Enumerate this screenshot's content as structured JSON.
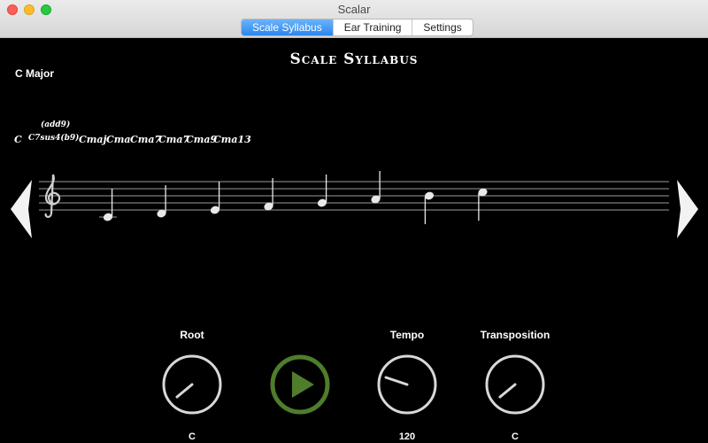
{
  "window": {
    "title": "Scalar"
  },
  "tabs": [
    {
      "label": "Scale Syllabus",
      "active": true
    },
    {
      "label": "Ear Training",
      "active": false
    },
    {
      "label": "Settings",
      "active": false
    }
  ],
  "main": {
    "title": "Scale Syllabus",
    "scale_name": "C Major",
    "chords": {
      "c": "C",
      "c7sus4": "C7sus4(b9)",
      "c7sus4_super": "(add9)",
      "cmaj": "Cmaj",
      "cma": "Cma",
      "cma7": "Cma7",
      "cma7b": "Cma7",
      "cma9": "Cma9",
      "cma13": "Cma13"
    },
    "notes": [
      "C4",
      "D4",
      "E4",
      "F4",
      "G4",
      "A4",
      "B4",
      "C5"
    ]
  },
  "controls": {
    "root": {
      "label": "Root",
      "value": "C"
    },
    "tempo": {
      "label": "Tempo",
      "value": "120"
    },
    "transposition": {
      "label": "Transposition",
      "value": "C"
    }
  },
  "colors": {
    "accent": "#2a86ee",
    "play": "#4f7d2b",
    "background": "#000000"
  },
  "icons": {
    "prev": "triangle-left-icon",
    "next": "triangle-right-icon",
    "play": "play-icon"
  }
}
